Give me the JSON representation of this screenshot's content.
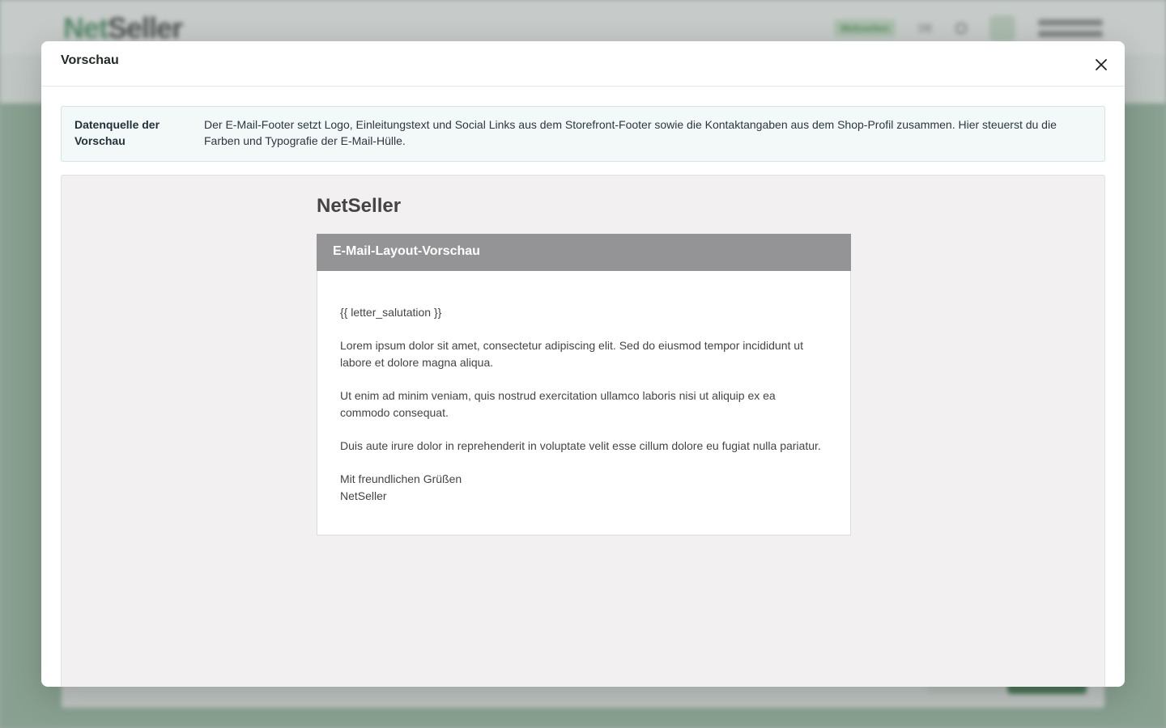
{
  "background": {
    "logo_net": "Net",
    "logo_seller": "Seller",
    "badge": "Webseiten",
    "lang": "DE"
  },
  "modal": {
    "title": "Vorschau",
    "close_icon": "close-icon",
    "info": {
      "label": "Datenquelle der Vorschau",
      "text": "Der E-Mail-Footer setzt Logo, Einleitungstext und Social Links aus dem Storefront-Footer sowie die Kontaktangaben aus dem Shop-Profil zusammen. Hier steuerst du die Farben und Typografie der E-Mail-Hülle."
    },
    "email": {
      "brand": "NetSeller",
      "header": "E-Mail-Layout-Vorschau",
      "salutation": "{{ letter_salutation }}",
      "paragraph1": "Lorem ipsum dolor sit amet, consectetur adipiscing elit. Sed do eiusmod tempor incididunt ut labore et dolore magna aliqua.",
      "paragraph2": "Ut enim ad minim veniam, quis nostrud exercitation ullamco laboris nisi ut aliquip ex ea commodo consequat.",
      "paragraph3": "Duis aute irure dolor in reprehenderit in voluptate velit esse cillum dolore eu fugiat nulla pariatur.",
      "closing": "Mit freundlichen Grüßen",
      "signature": "NetSeller"
    }
  },
  "colors": {
    "email_header_bg": "#949396",
    "preview_bg": "#f2f0f1",
    "info_bg": "#f3f8f9"
  }
}
